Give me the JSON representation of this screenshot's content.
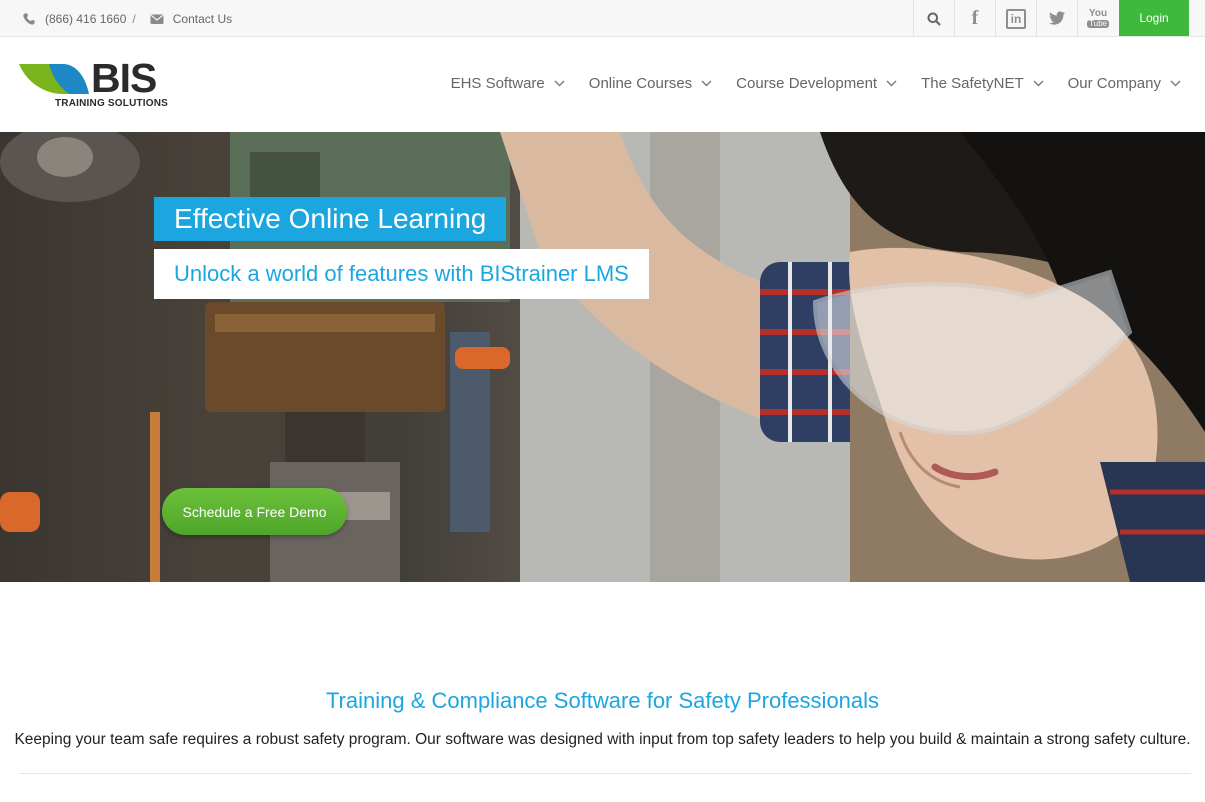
{
  "topbar": {
    "phone": "(866) 416 1660",
    "separator": "/",
    "contact_label": "Contact Us",
    "social": {
      "facebook": "f",
      "linkedin": "in",
      "youtube_top": "You",
      "youtube_bottom": "Tube"
    },
    "login_label": "Login"
  },
  "header": {
    "logo_word": "BIS",
    "logo_sub": "TRAINING SOLUTIONS",
    "nav": [
      {
        "label": "EHS Software"
      },
      {
        "label": "Online Courses"
      },
      {
        "label": "Course Development"
      },
      {
        "label": "The SafetyNET"
      },
      {
        "label": "Our Company"
      }
    ]
  },
  "hero": {
    "headline": "Effective Online Learning",
    "subheadline": "Unlock a world of features with BIStrainer LMS",
    "cta_label": "Schedule a Free Demo"
  },
  "intro": {
    "title": "Training & Compliance Software for Safety Professionals",
    "text": "Keeping your team safe requires a robust safety program. Our software was designed with input from top safety leaders to help you build & maintain a strong safety culture."
  },
  "colors": {
    "accent_blue": "#1ba6e0",
    "green": "#3fb93c",
    "logo_green": "#7ab51d",
    "logo_blue": "#1e88c7"
  }
}
